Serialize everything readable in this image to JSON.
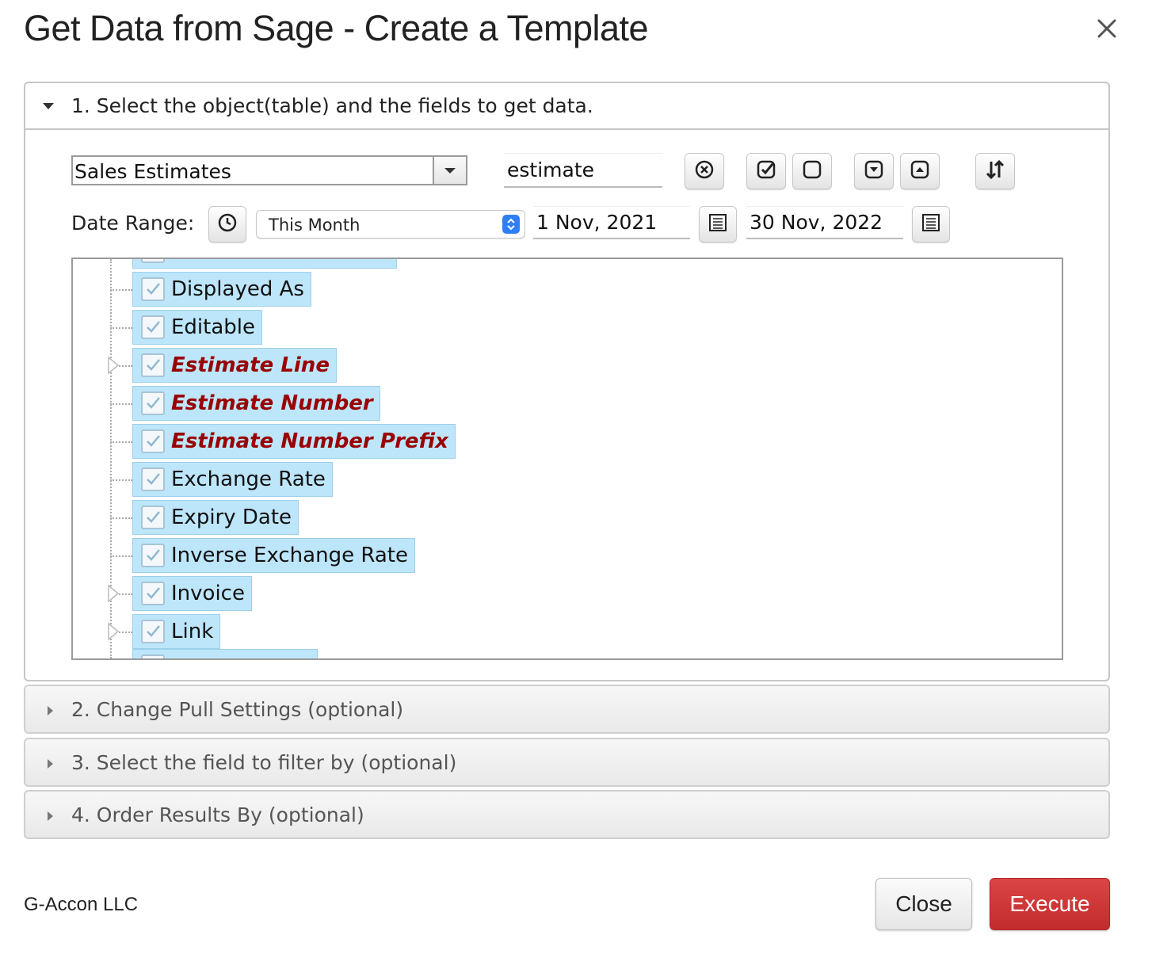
{
  "dialog": {
    "title": "Get Data from Sage - Create a Template",
    "close_icon": "close-icon"
  },
  "step1": {
    "header": "1. Select the object(table) and the fields to get data.",
    "object_select": {
      "value": "Sales Estimates"
    },
    "search": {
      "value": "estimate"
    },
    "toolbar_icons": [
      "clear-search-icon",
      "check-all-icon",
      "uncheck-all-icon",
      "expand-all-icon",
      "collapse-all-icon",
      "sort-icon"
    ],
    "date_range": {
      "label": "Date Range:",
      "preset": "This Month",
      "from": "1 Nov, 2021",
      "to": "30 Nov, 2022"
    },
    "fields": [
      {
        "label": "Displayed As",
        "required": false,
        "expandable": false,
        "checked": true
      },
      {
        "label": "Editable",
        "required": false,
        "expandable": false,
        "checked": true
      },
      {
        "label": "Estimate Line",
        "required": true,
        "expandable": true,
        "checked": true
      },
      {
        "label": "Estimate Number",
        "required": true,
        "expandable": false,
        "checked": true
      },
      {
        "label": "Estimate Number Prefix",
        "required": true,
        "expandable": false,
        "checked": true
      },
      {
        "label": "Exchange Rate",
        "required": false,
        "expandable": false,
        "checked": true
      },
      {
        "label": "Expiry Date",
        "required": false,
        "expandable": false,
        "checked": true
      },
      {
        "label": "Inverse Exchange Rate",
        "required": false,
        "expandable": false,
        "checked": true
      },
      {
        "label": "Invoice",
        "required": false,
        "expandable": true,
        "checked": true
      },
      {
        "label": "Link",
        "required": false,
        "expandable": true,
        "checked": true
      }
    ]
  },
  "step2": {
    "header": "2. Change Pull Settings (optional)"
  },
  "step3": {
    "header": "3. Select the field to filter by (optional)"
  },
  "step4": {
    "header": "4. Order Results By (optional)"
  },
  "footer": {
    "company": "G-Accon LLC",
    "close_label": "Close",
    "execute_label": "Execute",
    "execute_color": "#c93434"
  }
}
